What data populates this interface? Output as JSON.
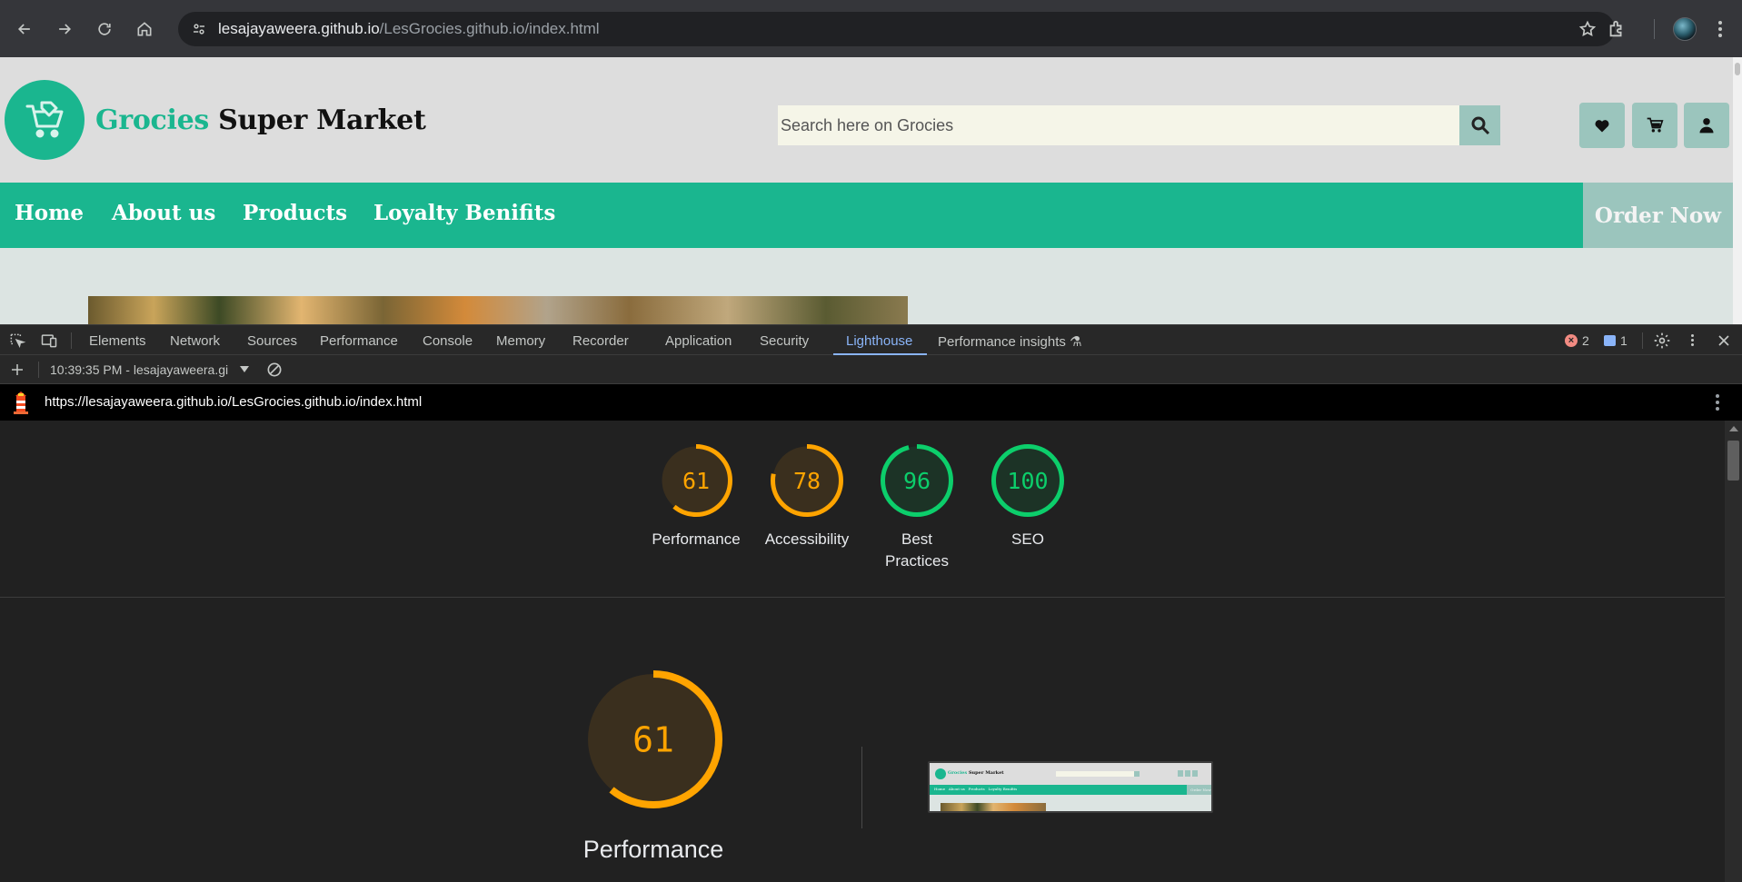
{
  "browser": {
    "url_host": "lesajayaweera.github.io",
    "url_path": "/LesGrocies.github.io/index.html"
  },
  "site": {
    "brand_green": "Grocies",
    "brand_dark": "Super Market",
    "search_placeholder": "Search here on Grocies",
    "nav": [
      "Home",
      "About us",
      "Products",
      "Loyalty Benifits"
    ],
    "order_now": "Order Now",
    "colors": {
      "primary": "#1ab68f",
      "muted": "#9bc5bd"
    }
  },
  "devtools": {
    "tabs": [
      "Elements",
      "Network",
      "Sources",
      "Performance",
      "Console",
      "Memory",
      "Recorder",
      "Application",
      "Security",
      "Lighthouse",
      "Performance insights"
    ],
    "active_tab": "Lighthouse",
    "error_count": "2",
    "message_count": "1",
    "report_time": "10:39:35 PM - lesajayaweera.gi",
    "report_url": "https://lesajayaweera.github.io/LesGrocies.github.io/index.html"
  },
  "lighthouse": {
    "scores": [
      {
        "label": "Performance",
        "value": 61,
        "color": "#ffa400"
      },
      {
        "label": "Accessibility",
        "value": 78,
        "color": "#ffa400"
      },
      {
        "label": "Best Practices",
        "value": 96,
        "color": "#0cce6b"
      },
      {
        "label": "SEO",
        "value": 100,
        "color": "#0cce6b"
      }
    ],
    "main_score": {
      "label": "Performance",
      "value": 61,
      "color": "#ffa400"
    }
  }
}
